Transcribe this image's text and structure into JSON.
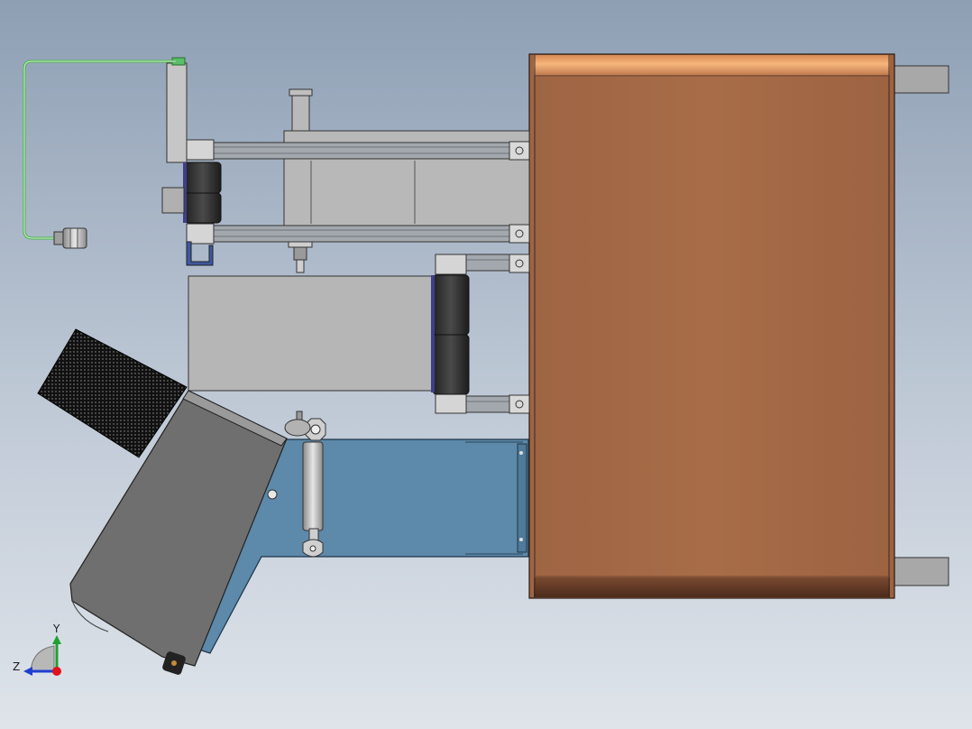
{
  "triad": {
    "y_label": "Y",
    "z_label": "Z"
  },
  "colors": {
    "background_top": "#8e9fb4",
    "background_bottom": "#dfe4ea",
    "copper_housing": "#a46a47",
    "housing_highlight": "#f2b079",
    "gray_body": "#b5b5b5",
    "hopper_gray": "#6f6f6f",
    "bracket_blue": "#5d89aa",
    "roller_dark": "#3b3b3b",
    "cable_green": "#49b34a",
    "axis_y": "#1fa12f",
    "axis_z": "#1f3fd1",
    "axis_origin": "#e0121b"
  }
}
